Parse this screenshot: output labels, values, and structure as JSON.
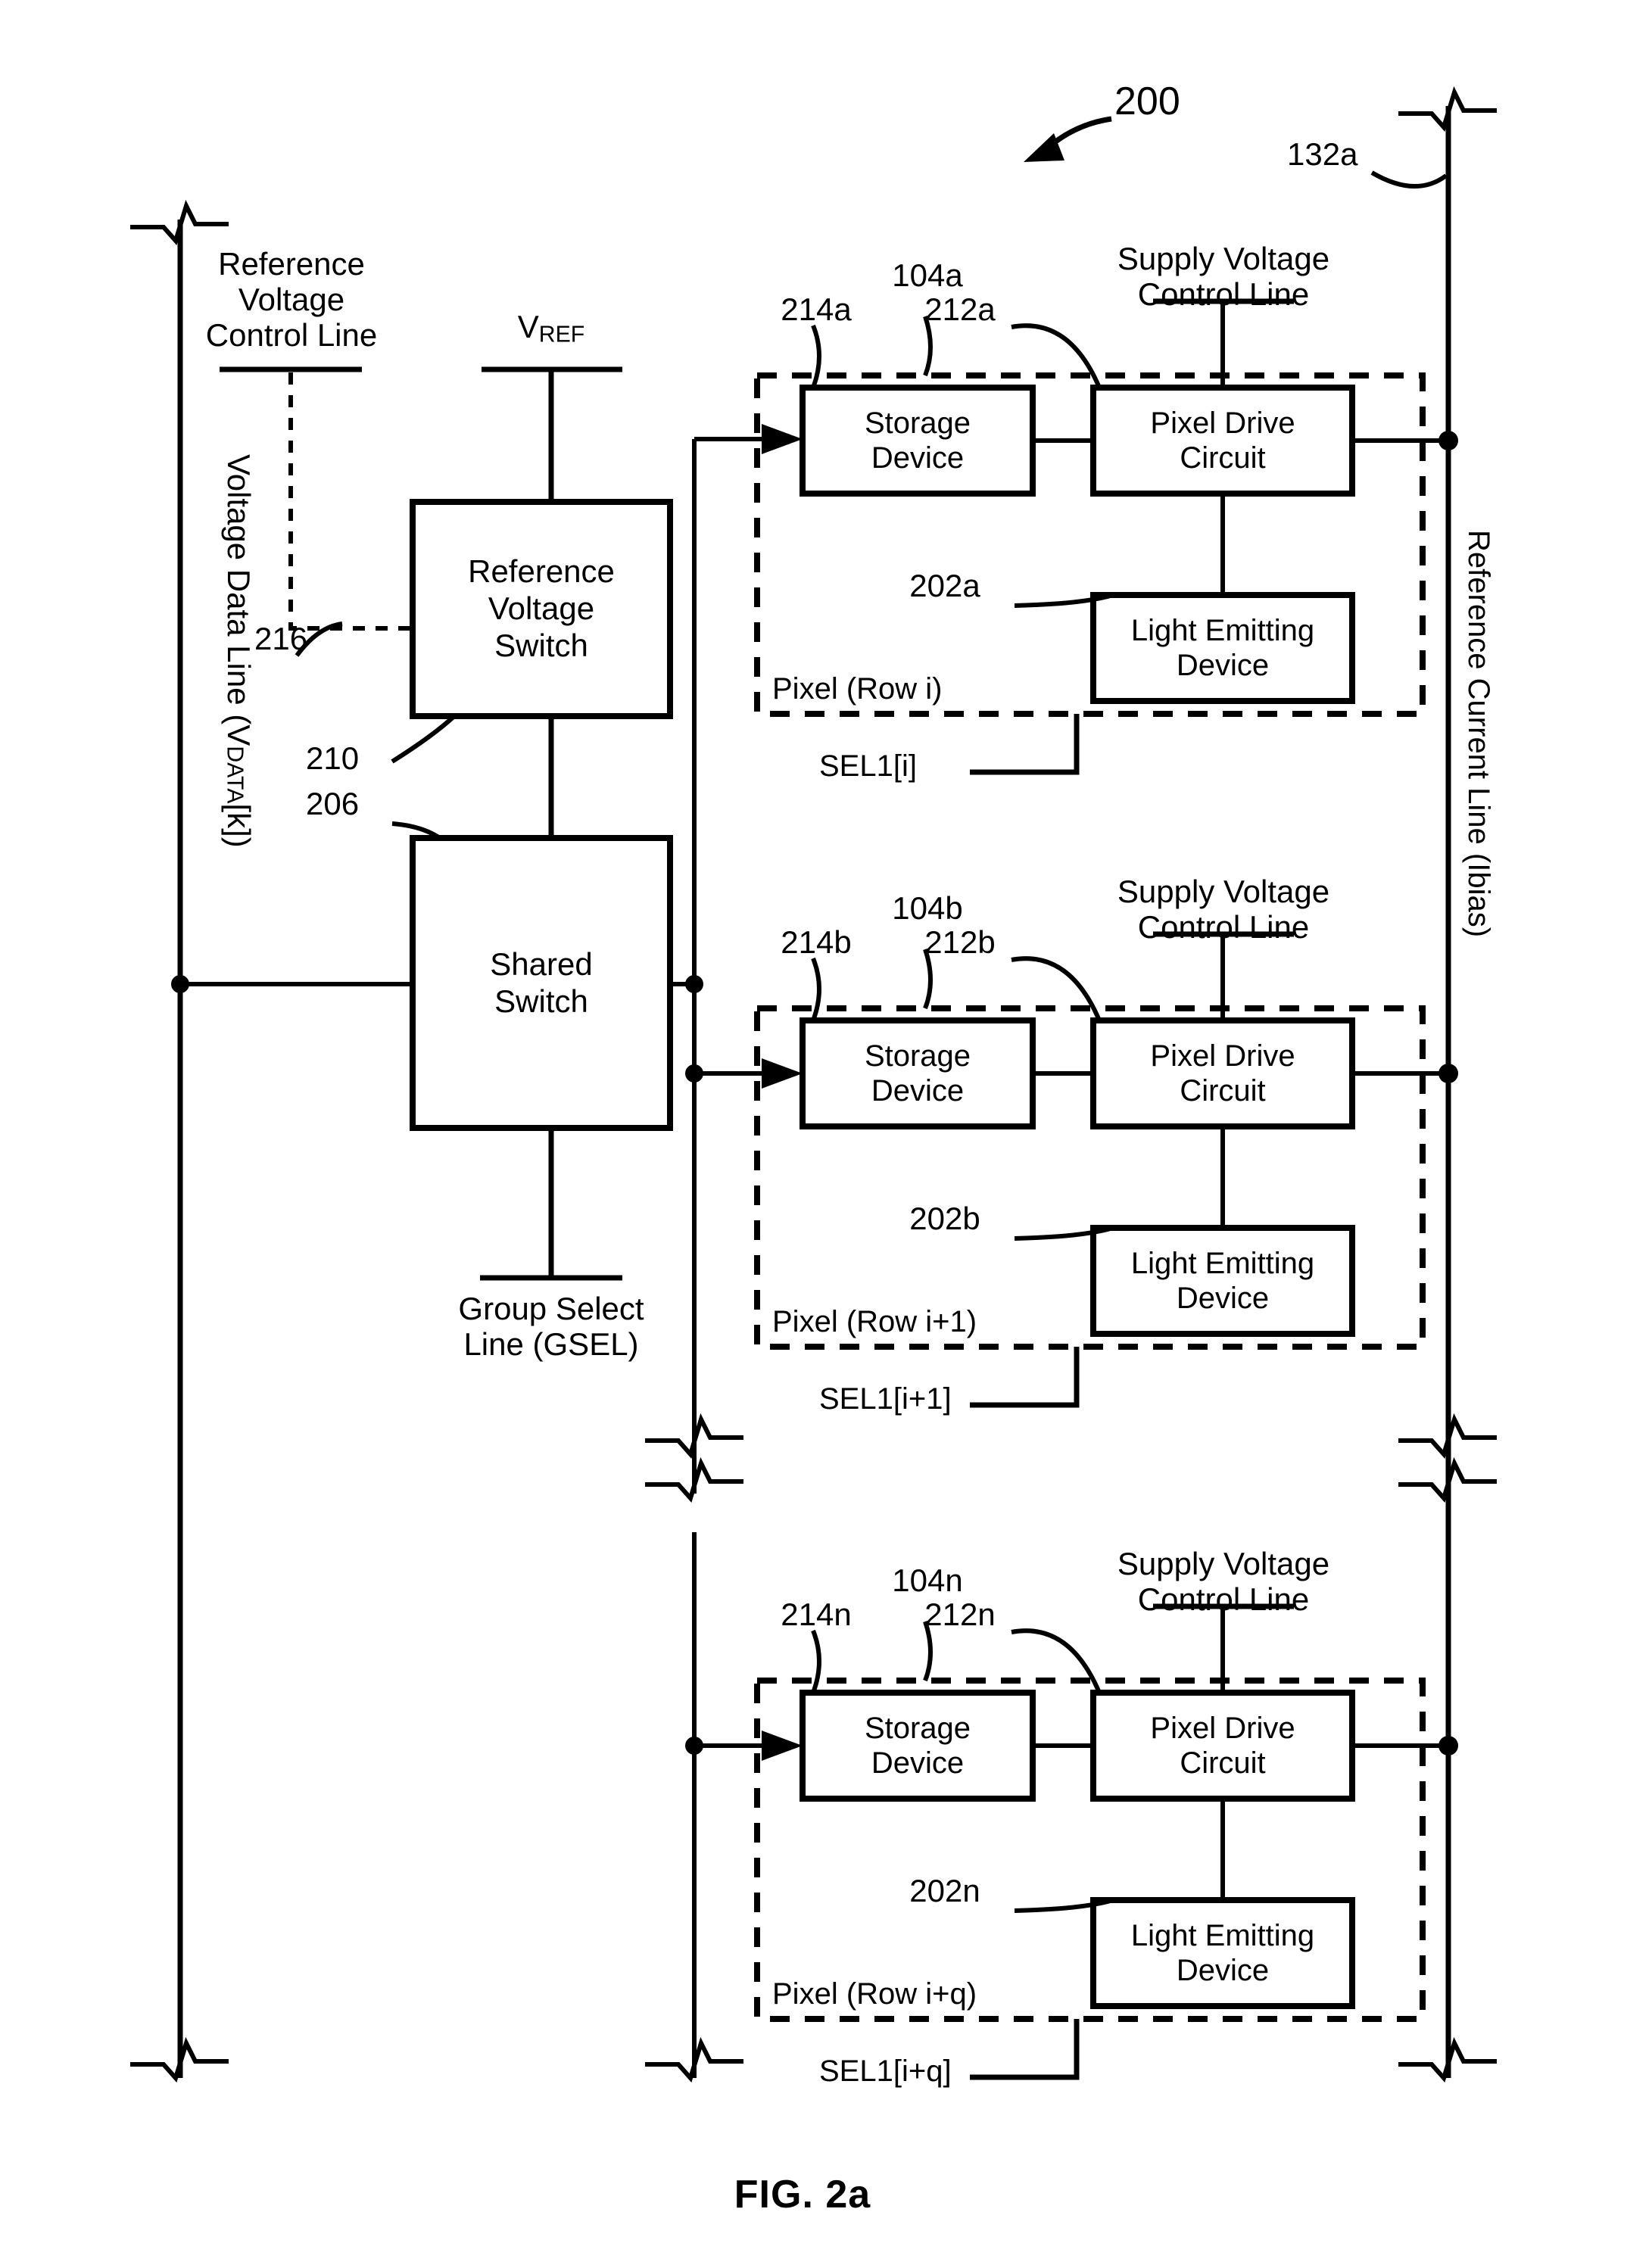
{
  "figure": {
    "caption": "FIG. 2a",
    "overall_ref": "200"
  },
  "left_column": {
    "data_line_label": "Voltage Data Line (V",
    "data_line_sub": "DATA",
    "data_line_tail": "[k])",
    "ref_voltage_control_line": "Reference\nVoltage\nControl Line",
    "ref_voltage_control_line_l1": "Reference",
    "ref_voltage_control_line_l2": "Voltage",
    "ref_voltage_control_line_l3": "Control Line",
    "ref_voltage_control_ref": "216",
    "vref_label": "V",
    "vref_sub": "REF",
    "ref_voltage_switch": "Reference\nVoltage\nSwitch",
    "ref_voltage_switch_l1": "Reference",
    "ref_voltage_switch_l2": "Voltage",
    "ref_voltage_switch_l3": "Switch",
    "ref_voltage_switch_ref": "210",
    "shared_switch_l1": "Shared",
    "shared_switch_l2": "Switch",
    "shared_switch_ref": "206",
    "group_select_line_l1": "Group Select",
    "group_select_line_l2": "Line (GSEL)"
  },
  "right_column": {
    "ref_current_line_label": "Reference Current Line (Ibias)",
    "ref_current_line_ref": "132a"
  },
  "pixels": [
    {
      "pixel_ref": "104a",
      "storage_ref": "214a",
      "drive_ref": "212a",
      "led_ref": "202a",
      "storage_l1": "Storage",
      "storage_l2": "Device",
      "drive_l1": "Pixel Drive",
      "drive_l2": "Circuit",
      "led_l1": "Light Emitting",
      "led_l2": "Device",
      "pixel_caption": "Pixel (Row i)",
      "supply_line_l1": "Supply Voltage",
      "supply_line_l2": "Control Line",
      "select_line": "SEL1[i]"
    },
    {
      "pixel_ref": "104b",
      "storage_ref": "214b",
      "drive_ref": "212b",
      "led_ref": "202b",
      "storage_l1": "Storage",
      "storage_l2": "Device",
      "drive_l1": "Pixel Drive",
      "drive_l2": "Circuit",
      "led_l1": "Light Emitting",
      "led_l2": "Device",
      "pixel_caption": "Pixel (Row i+1)",
      "supply_line_l1": "Supply Voltage",
      "supply_line_l2": "Control Line",
      "select_line": "SEL1[i+1]"
    },
    {
      "pixel_ref": "104n",
      "storage_ref": "214n",
      "drive_ref": "212n",
      "led_ref": "202n",
      "storage_l1": "Storage",
      "storage_l2": "Device",
      "drive_l1": "Pixel Drive",
      "drive_l2": "Circuit",
      "led_l1": "Light Emitting",
      "led_l2": "Device",
      "pixel_caption": "Pixel (Row i+q)",
      "supply_line_l1": "Supply Voltage",
      "supply_line_l2": "Control Line",
      "select_line": "SEL1[i+q]"
    }
  ],
  "colors": {
    "ink": "#000000",
    "paper": "#ffffff"
  }
}
